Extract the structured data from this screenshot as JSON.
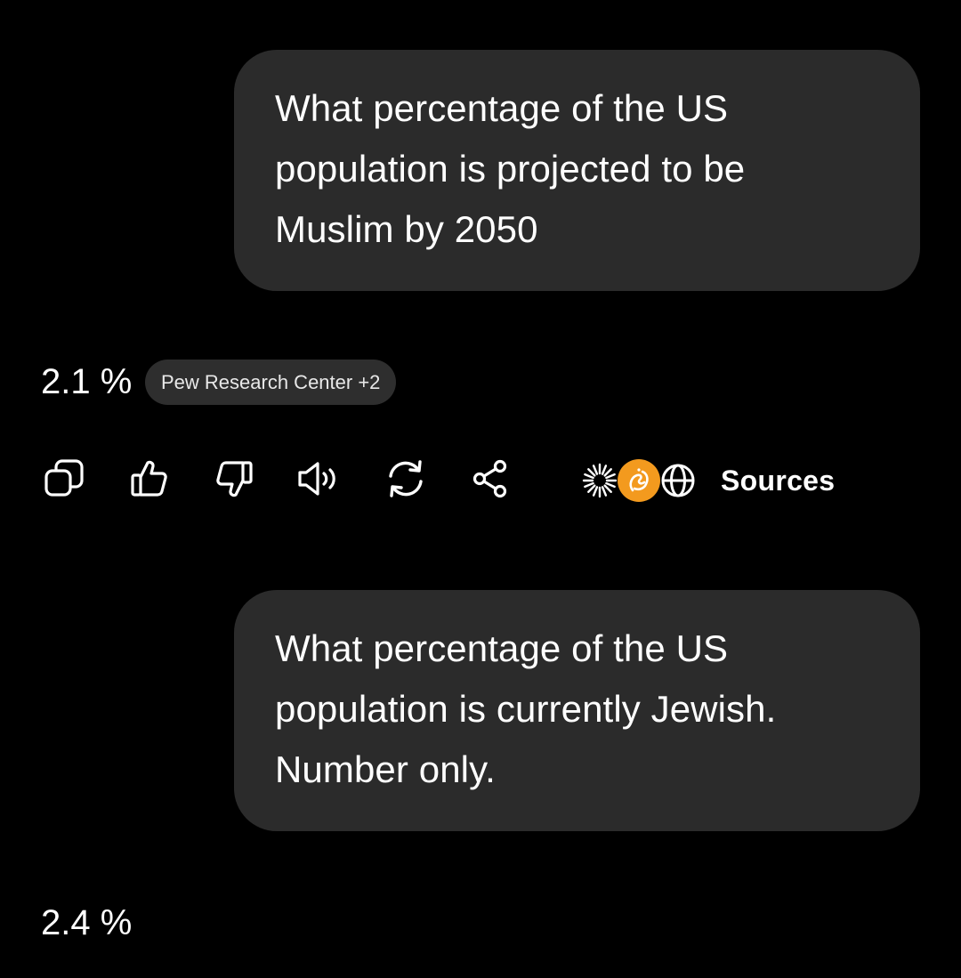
{
  "conversation": [
    {
      "question": {
        "lines": [
          "What percentage of the US",
          "population is projected to be",
          "Muslim by 2050"
        ]
      },
      "answer": "2.1 %",
      "source_chip": "Pew Research Center +2"
    },
    {
      "question": {
        "lines": [
          "What percentage of the US",
          "population is currently Jewish.",
          "Number only."
        ]
      },
      "answer": "2.4 %"
    }
  ],
  "actions": {
    "icons": [
      "copy-icon",
      "thumbs-up-icon",
      "thumbs-down-icon",
      "speaker-icon",
      "regenerate-icon",
      "share-icon"
    ],
    "sources_label": "Sources",
    "source_icons": [
      "pew-burst-icon",
      "aljazeera-logo-icon",
      "globe-icon"
    ]
  },
  "colors": {
    "background": "#000000",
    "bubble": "#2b2b2b",
    "chip": "#2e2e2e",
    "text": "#ffffff",
    "accent_orange": "#f39a1e"
  }
}
